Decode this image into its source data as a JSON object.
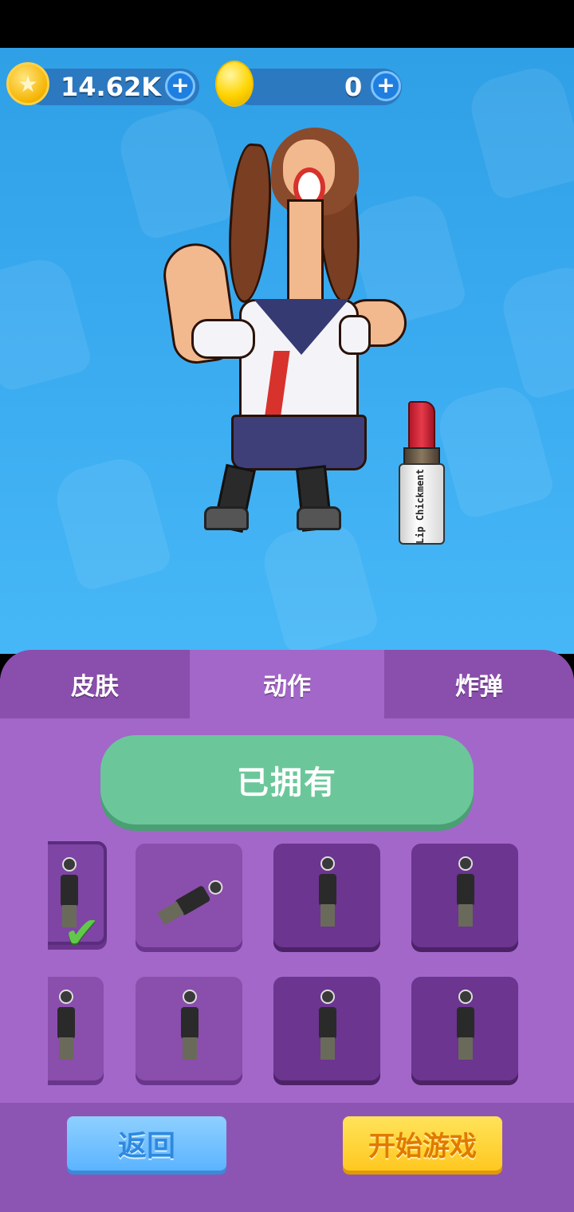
{
  "currency": {
    "coins": {
      "value": "14.62K",
      "icon": "star-coin-icon",
      "add_icon": "plus-icon"
    },
    "gems": {
      "value": "0",
      "icon": "gold-egg-icon",
      "add_icon": "plus-icon"
    }
  },
  "preview": {
    "prop_label": "Lip Chickment"
  },
  "tabs": [
    {
      "label": "皮肤",
      "active": false
    },
    {
      "label": "动作",
      "active": true
    },
    {
      "label": "炸弹",
      "active": false
    }
  ],
  "owned_button": {
    "label": "已拥有"
  },
  "emotes": {
    "slots": [
      {
        "state": "selected",
        "checked": true
      },
      {
        "state": "owned"
      },
      {
        "state": "locked"
      },
      {
        "state": "locked"
      },
      {
        "state": "owned"
      },
      {
        "state": "owned"
      },
      {
        "state": "locked"
      },
      {
        "state": "locked"
      }
    ],
    "check_icon": "checkmark-icon"
  },
  "footer": {
    "back_label": "返回",
    "start_label": "开始游戏"
  },
  "colors": {
    "sky": "#3aaaf0",
    "panel": "#a367c9",
    "owned_green": "#6bc79a",
    "back_blue": "#5cb4ff",
    "start_yellow": "#ffc820"
  }
}
